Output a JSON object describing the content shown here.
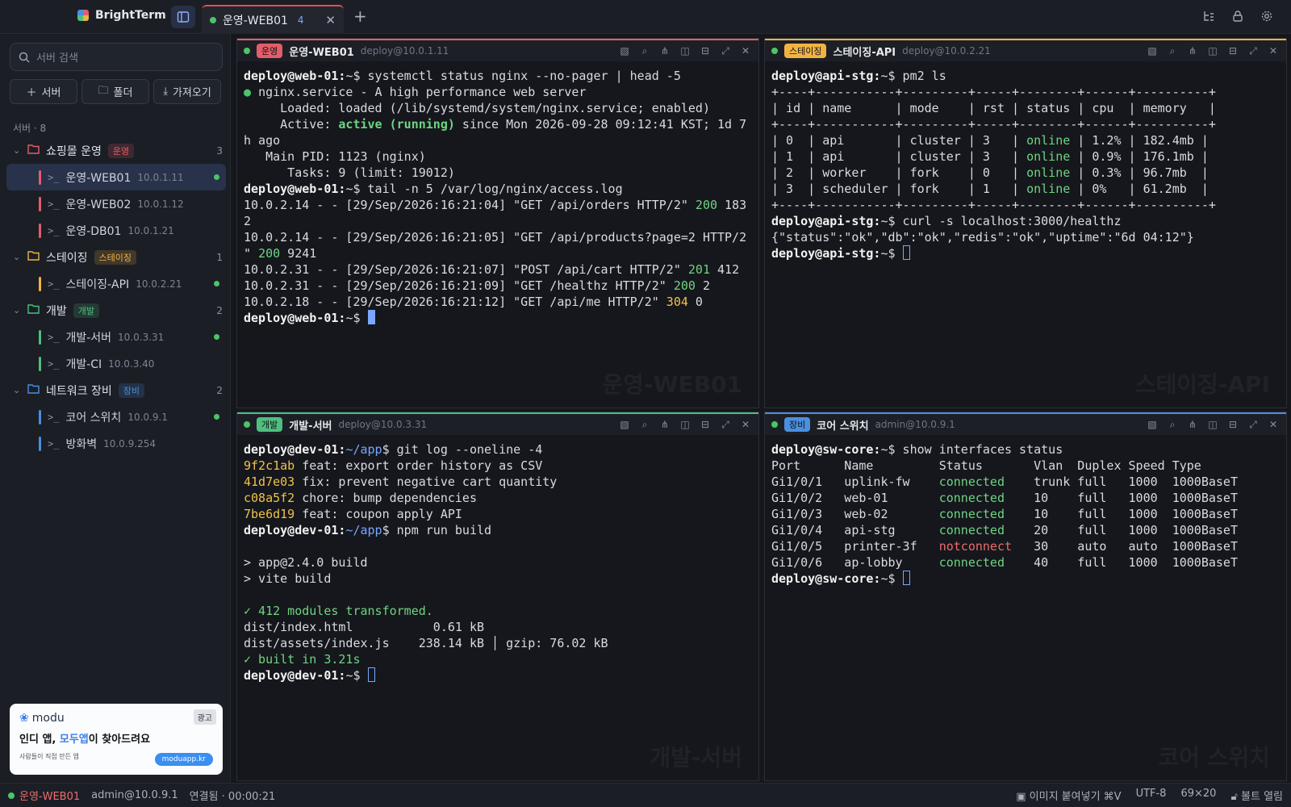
{
  "app": {
    "name": "BrightTerm"
  },
  "tab": {
    "label": "운영-WEB01",
    "count": "4"
  },
  "sidebar": {
    "search_placeholder": "서버 검색",
    "buttons": {
      "server": "서버",
      "folder": "폴더",
      "import": "가져오기"
    },
    "section_title": "서버 · 8",
    "groups": [
      {
        "name": "쇼핑몰 운영",
        "badge": "운영",
        "count": "3",
        "color": "#e35d6a",
        "servers": [
          {
            "name": "운영-WEB01",
            "ip": "10.0.1.11",
            "online": true
          },
          {
            "name": "운영-WEB02",
            "ip": "10.0.1.12",
            "online": false
          },
          {
            "name": "운영-DB01",
            "ip": "10.0.1.21",
            "online": false
          }
        ]
      },
      {
        "name": "스테이징",
        "badge": "스테이징",
        "count": "1",
        "color": "#f0b343",
        "servers": [
          {
            "name": "스테이징-API",
            "ip": "10.0.2.21",
            "online": true
          }
        ]
      },
      {
        "name": "개발",
        "badge": "개발",
        "count": "2",
        "color": "#4fbf7f",
        "servers": [
          {
            "name": "개발-서버",
            "ip": "10.0.3.31",
            "online": true
          },
          {
            "name": "개발-CI",
            "ip": "10.0.3.40",
            "online": false
          }
        ]
      },
      {
        "name": "네트워크 장비",
        "badge": "장비",
        "count": "2",
        "color": "#4a8fe0",
        "servers": [
          {
            "name": "코어 스위치",
            "ip": "10.0.9.1",
            "online": true
          },
          {
            "name": "방화벽",
            "ip": "10.0.9.254",
            "online": false
          }
        ]
      }
    ]
  },
  "ad": {
    "logo": "modu",
    "tag": "광고",
    "headline_pre": "인디 앱, ",
    "headline_hl": "모두앱",
    "headline_post": "이 찾아드려요",
    "sub": "사람들이 직접 만든 앱",
    "url": "moduapp.kr"
  },
  "panes": [
    {
      "badge": "운영",
      "name": "운영-WEB01",
      "host": "deploy@10.0.1.11",
      "color": "#e35d6a",
      "watermark": "운영-WEB01",
      "lines": [
        [
          {
            "t": "deploy@web-01:",
            "c": "#f2f2f2",
            "b": true
          },
          {
            "t": "~$ systemctl status nginx --no-pager | head -5"
          }
        ],
        [
          {
            "t": "● ",
            "c": "#4cc46a"
          },
          {
            "t": "nginx.service - A high performance web server"
          }
        ],
        [
          {
            "t": "     Loaded: loaded (/lib/systemd/system/nginx.service; enabled)"
          }
        ],
        [
          {
            "t": "     Active: "
          },
          {
            "t": "active (running)",
            "c": "#6fd482",
            "b": true
          },
          {
            "t": " since Mon 2026-09-28 09:12:41 KST; 1d 7"
          }
        ],
        [
          {
            "t": "h ago"
          }
        ],
        [
          {
            "t": "   Main PID: 1123 (nginx)"
          }
        ],
        [
          {
            "t": "      Tasks: 9 (limit: 19012)"
          }
        ],
        [
          {
            "t": "deploy@web-01:",
            "c": "#f2f2f2",
            "b": true
          },
          {
            "t": "~$ tail -n 5 /var/log/nginx/access.log"
          }
        ],
        [
          {
            "t": "10.0.2.14 - - [29/Sep/2026:16:21:04] \"GET /api/orders HTTP/2\" "
          },
          {
            "t": "200",
            "c": "#6fd482"
          },
          {
            "t": " 183"
          }
        ],
        [
          {
            "t": "2"
          }
        ],
        [
          {
            "t": "10.0.2.14 - - [29/Sep/2026:16:21:05] \"GET /api/products?page=2 HTTP/2"
          }
        ],
        [
          {
            "t": "\" "
          },
          {
            "t": "200",
            "c": "#6fd482"
          },
          {
            "t": " 9241"
          }
        ],
        [
          {
            "t": "10.0.2.31 - - [29/Sep/2026:16:21:07] \"POST /api/cart HTTP/2\" "
          },
          {
            "t": "201",
            "c": "#6fd482"
          },
          {
            "t": " 412"
          }
        ],
        [
          {
            "t": "10.0.2.31 - - [29/Sep/2026:16:21:09] \"GET /healthz HTTP/2\" "
          },
          {
            "t": "200",
            "c": "#6fd482"
          },
          {
            "t": " 2"
          }
        ],
        [
          {
            "t": "10.0.2.18 - - [29/Sep/2026:16:21:12] \"GET /api/me HTTP/2\" "
          },
          {
            "t": "304",
            "c": "#f0c24b"
          },
          {
            "t": " 0"
          }
        ],
        [
          {
            "t": "deploy@web-01:",
            "c": "#f2f2f2",
            "b": true
          },
          {
            "t": "~$ "
          },
          {
            "cursor": "solid"
          }
        ]
      ]
    },
    {
      "badge": "스테이징",
      "name": "스테이징-API",
      "host": "deploy@10.0.2.21",
      "color": "#f0b343",
      "watermark": "스테이징-API",
      "lines": [
        [
          {
            "t": "deploy@api-stg:",
            "c": "#f2f2f2",
            "b": true
          },
          {
            "t": "~$ pm2 ls"
          }
        ],
        [
          {
            "t": "+----+-----------+---------+-----+--------+------+----------+"
          }
        ],
        [
          {
            "t": "| id | name      | mode    | rst | status | cpu  | memory   |"
          }
        ],
        [
          {
            "t": "+----+-----------+---------+-----+--------+------+----------+"
          }
        ],
        [
          {
            "t": "| 0  | api       | cluster | 3   | "
          },
          {
            "t": "online",
            "c": "#6fd482"
          },
          {
            "t": " | 1.2% | 182.4mb |"
          }
        ],
        [
          {
            "t": "| 1  | api       | cluster | 3   | "
          },
          {
            "t": "online",
            "c": "#6fd482"
          },
          {
            "t": " | 0.9% | 176.1mb |"
          }
        ],
        [
          {
            "t": "| 2  | worker    | fork    | 0   | "
          },
          {
            "t": "online",
            "c": "#6fd482"
          },
          {
            "t": " | 0.3% | 96.7mb  |"
          }
        ],
        [
          {
            "t": "| 3  | scheduler | fork    | 1   | "
          },
          {
            "t": "online",
            "c": "#6fd482"
          },
          {
            "t": " | 0%   | 61.2mb  |"
          }
        ],
        [
          {
            "t": "+----+-----------+---------+-----+--------+------+----------+"
          }
        ],
        [
          {
            "t": "deploy@api-stg:",
            "c": "#f2f2f2",
            "b": true
          },
          {
            "t": "~$ curl -s localhost:3000/healthz"
          }
        ],
        [
          {
            "t": "{\"status\":\"ok\",\"db\":\"ok\",\"redis\":\"ok\",\"uptime\":\"6d 04:12\"}"
          }
        ],
        [
          {
            "t": "deploy@api-stg:",
            "c": "#f2f2f2",
            "b": true
          },
          {
            "t": "~$ "
          },
          {
            "cursor": "hollow"
          }
        ]
      ]
    },
    {
      "badge": "개발",
      "name": "개발-서버",
      "host": "deploy@10.0.3.31",
      "color": "#4fbf7f",
      "watermark": "개발-서버",
      "lines": [
        [
          {
            "t": "deploy@dev-01:",
            "c": "#f2f2f2",
            "b": true
          },
          {
            "t": "~/app",
            "c": "#7aa7ff"
          },
          {
            "t": "$ git log --oneline -4"
          }
        ],
        [
          {
            "t": "9f2c1ab",
            "c": "#f0c24b"
          },
          {
            "t": " feat: export order history as CSV"
          }
        ],
        [
          {
            "t": "41d7e03",
            "c": "#f0c24b"
          },
          {
            "t": " fix: prevent negative cart quantity"
          }
        ],
        [
          {
            "t": "c08a5f2",
            "c": "#f0c24b"
          },
          {
            "t": " chore: bump dependencies"
          }
        ],
        [
          {
            "t": "7be6d19",
            "c": "#f0c24b"
          },
          {
            "t": " feat: coupon apply API"
          }
        ],
        [
          {
            "t": "deploy@dev-01:",
            "c": "#f2f2f2",
            "b": true
          },
          {
            "t": "~/app",
            "c": "#7aa7ff"
          },
          {
            "t": "$ npm run build"
          }
        ],
        [
          {
            "t": ""
          }
        ],
        [
          {
            "t": "> app@2.4.0 build"
          }
        ],
        [
          {
            "t": "> vite build"
          }
        ],
        [
          {
            "t": ""
          }
        ],
        [
          {
            "t": "✓ 412 modules transformed.",
            "c": "#6fd482"
          }
        ],
        [
          {
            "t": "dist/index.html           0.61 kB"
          }
        ],
        [
          {
            "t": "dist/assets/index.js    238.14 kB │ gzip: 76.02 kB"
          }
        ],
        [
          {
            "t": "✓ built in 3.21s",
            "c": "#6fd482"
          }
        ],
        [
          {
            "t": "deploy@dev-01:",
            "c": "#f2f2f2",
            "b": true
          },
          {
            "t": "~$ "
          },
          {
            "cursor": "hollow"
          }
        ]
      ]
    },
    {
      "badge": "장비",
      "name": "코어 스위치",
      "host": "admin@10.0.9.1",
      "color": "#4a8fe0",
      "watermark": "코어 스위치",
      "lines": [
        [
          {
            "t": "deploy@sw-core:",
            "c": "#f2f2f2",
            "b": true
          },
          {
            "t": "~$ show interfaces status"
          }
        ],
        [
          {
            "t": "Port      Name         Status       Vlan  Duplex Speed Type"
          }
        ],
        [
          {
            "t": "Gi1/0/1   uplink-fw    "
          },
          {
            "t": "connected",
            "c": "#6fd482"
          },
          {
            "t": "    trunk full   1000  1000BaseT"
          }
        ],
        [
          {
            "t": "Gi1/0/2   web-01       "
          },
          {
            "t": "connected",
            "c": "#6fd482"
          },
          {
            "t": "    10    full   1000  1000BaseT"
          }
        ],
        [
          {
            "t": "Gi1/0/3   web-02       "
          },
          {
            "t": "connected",
            "c": "#6fd482"
          },
          {
            "t": "    10    full   1000  1000BaseT"
          }
        ],
        [
          {
            "t": "Gi1/0/4   api-stg      "
          },
          {
            "t": "connected",
            "c": "#6fd482"
          },
          {
            "t": "    20    full   1000  1000BaseT"
          }
        ],
        [
          {
            "t": "Gi1/0/5   printer-3f   "
          },
          {
            "t": "notconnect",
            "c": "#ef6b6b"
          },
          {
            "t": "   30    auto   auto  1000BaseT"
          }
        ],
        [
          {
            "t": "Gi1/0/6   ap-lobby     "
          },
          {
            "t": "connected",
            "c": "#6fd482"
          },
          {
            "t": "    40    full   1000  1000BaseT"
          }
        ],
        [
          {
            "t": "deploy@sw-core:",
            "c": "#f2f2f2",
            "b": true
          },
          {
            "t": "~$ "
          },
          {
            "cursor": "hollow"
          }
        ]
      ]
    }
  ],
  "statusbar": {
    "active": "운영-WEB01",
    "user": "admin@10.0.9.1",
    "conn": "연결됨 · 00:00:21",
    "paste": "이미지 붙여넣기 ⌘V",
    "enc": "UTF-8",
    "size": "69×20",
    "vault": "볼트 열림"
  }
}
